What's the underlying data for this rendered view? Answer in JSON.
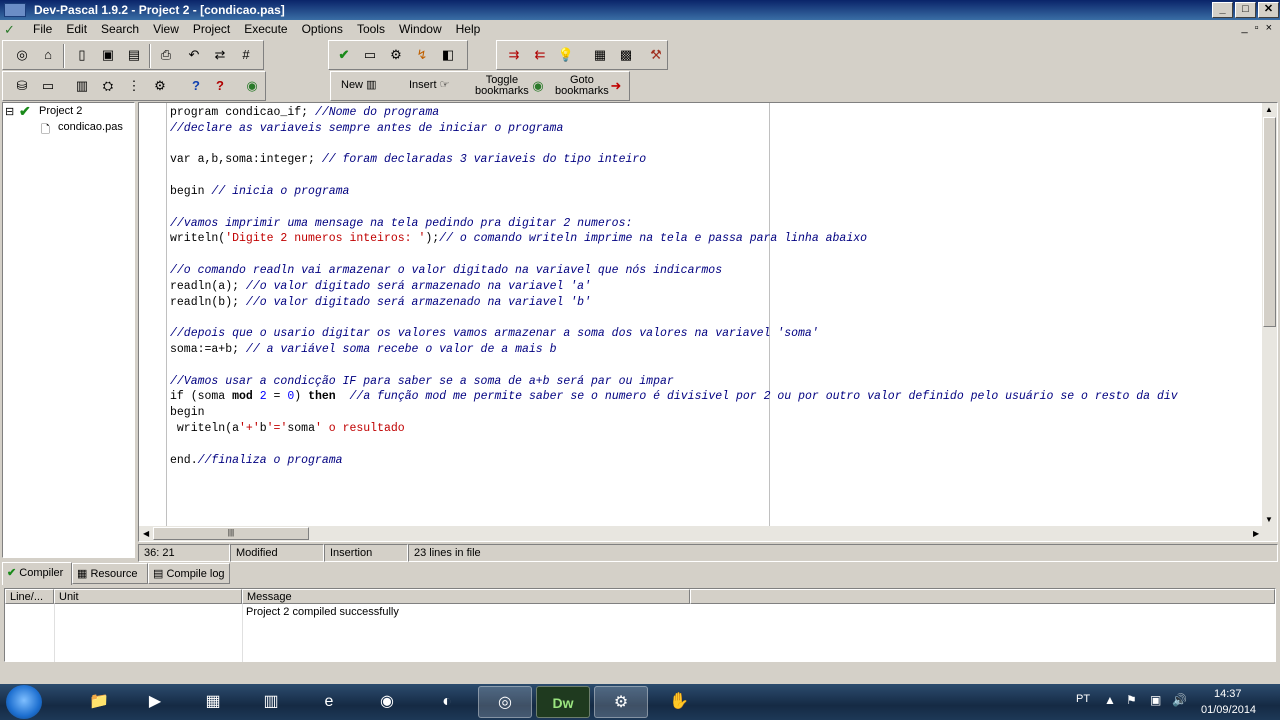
{
  "window": {
    "title": "Dev-Pascal 1.9.2 - Project 2 - [condicao.pas]"
  },
  "menu": [
    "File",
    "Edit",
    "Search",
    "View",
    "Project",
    "Execute",
    "Options",
    "Tools",
    "Window",
    "Help"
  ],
  "toolbar2": {
    "new_label": "New",
    "insert_label": "Insert",
    "toggle_label_1": "Toggle",
    "toggle_label_2": "bookmarks",
    "goto_label_1": "Goto",
    "goto_label_2": "bookmarks"
  },
  "tree": {
    "project": "Project 2",
    "file": "condicao.pas"
  },
  "editor": {
    "lines": [
      "program condicao_if; //Nome do programa",
      "//declare as variaveis sempre antes de iniciar o programa",
      "",
      "var a,b,soma:integer; // foram declaradas 3 variaveis do tipo inteiro",
      "",
      "begin // inicia o programa",
      "",
      "//vamos imprimir uma mensage na tela pedindo pra digitar 2 numeros:",
      "writeln('Digite 2 numeros inteiros: ');// o comando writeln imprime na tela e passa para linha abaixo",
      "",
      "//o comando readln vai armazenar o valor digitado na variavel que nós indicarmos",
      "readln(a); //o valor digitado será armazenado na variavel 'a'",
      "readln(b); //o valor digitado será armazenado na variavel 'b'",
      "",
      "//depois que o usario digitar os valores vamos armazenar a soma dos valores na variavel 'soma'",
      "soma:=a+b; // a variável soma recebe o valor de a mais b",
      "",
      "//Vamos usar a condicção IF para saber se a soma de a+b será par ou impar",
      "if (soma mod 2 = 0) then  //a função mod me permite saber se o numero é divisivel por 2 ou por outro valor definido pelo usuário se o resto da div",
      "begin",
      " writeln(a'+'b'='soma' o resultado",
      "",
      "end.//finaliza o programa"
    ]
  },
  "status": {
    "position": "36: 21",
    "state": "Modified",
    "mode": "Insertion",
    "lines": "23 lines in file"
  },
  "tabs": [
    "Compiler",
    "Resource",
    "Compile log"
  ],
  "messages": {
    "columns": [
      "Line/...",
      "Unit",
      "Message"
    ],
    "rows": [
      {
        "line": "",
        "unit": "",
        "message": "Project 2 compiled successfully"
      }
    ]
  },
  "tray": {
    "language": "PT",
    "time": "14:37",
    "date": "01/09/2014"
  },
  "colors": {
    "comment": "#000080",
    "string": "#c00000",
    "number": "#0000ff",
    "titlebar": "#0a246a"
  }
}
